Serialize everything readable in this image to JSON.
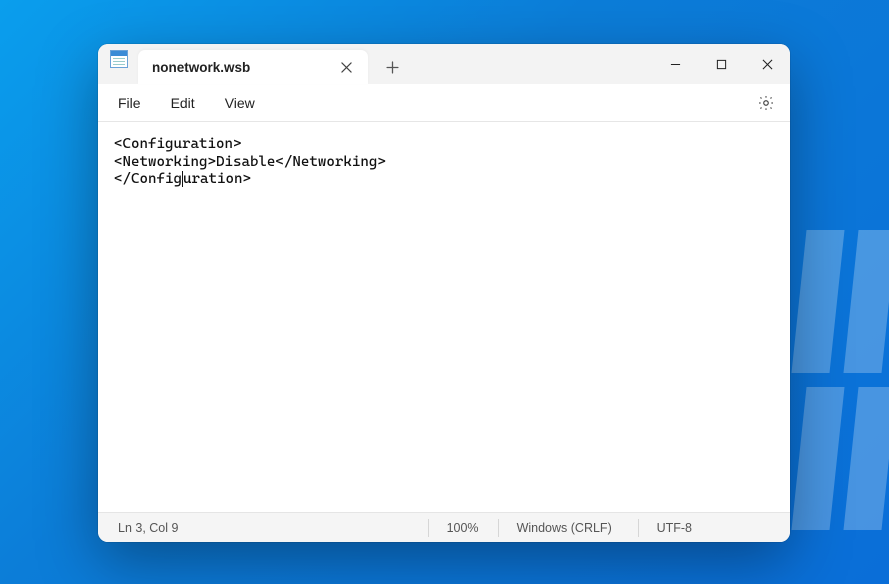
{
  "app": {
    "icon_name": "notepad-icon"
  },
  "tabs": [
    {
      "title": "nonetwork.wsb"
    }
  ],
  "menu": {
    "file": "File",
    "edit": "Edit",
    "view": "View"
  },
  "editor": {
    "lines": [
      "<Configuration>",
      "<Networking>Disable</Networking>",
      "</Configuration>"
    ],
    "caret": {
      "line": 3,
      "col": 9
    }
  },
  "statusbar": {
    "position": "Ln 3, Col 9",
    "zoom": "100%",
    "line_endings": "Windows (CRLF)",
    "encoding": "UTF-8"
  },
  "icons": {
    "close": "close-icon",
    "new_tab": "plus-icon",
    "minimize": "minimize-icon",
    "maximize": "maximize-icon",
    "window_close": "close-icon",
    "settings": "gear-icon"
  }
}
